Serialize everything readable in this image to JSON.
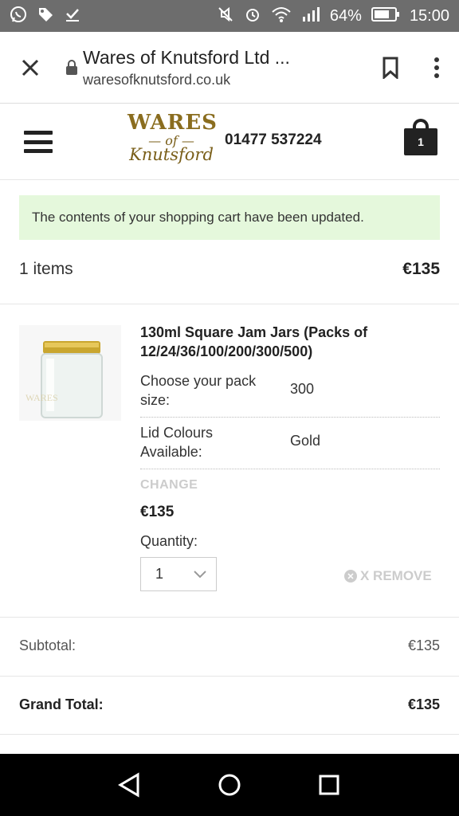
{
  "status_bar": {
    "battery": "64%",
    "time": "15:00"
  },
  "browser": {
    "page_title": "Wares of Knutsford Ltd ...",
    "url": "waresofknutsford.co.uk"
  },
  "site_header": {
    "logo_top": "WARES",
    "logo_mid": "— of —",
    "logo_bottom": "Knutsford",
    "phone": "01477 537224",
    "cart_count": "1"
  },
  "notice": "The contents of your shopping cart have been updated.",
  "cart_summary": {
    "items_count": "1 items",
    "items_total": "€135"
  },
  "product": {
    "name": "130ml Square Jam Jars (Packs of 12/24/36/100/200/300/500)",
    "options": [
      {
        "label": "Choose your pack size:",
        "value": "300"
      },
      {
        "label": "Lid Colours Available:",
        "value": "Gold"
      }
    ],
    "change_label": "CHANGE",
    "price": "€135",
    "quantity_label": "Quantity:",
    "quantity_value": "1",
    "remove_label": "X REMOVE"
  },
  "totals": {
    "subtotal_label": "Subtotal:",
    "subtotal_value": "€135",
    "grand_total_label": "Grand Total:",
    "grand_total_value": "€135"
  },
  "colors": {
    "notice_bg": "#e5f8dc",
    "status_bar_bg": "#6d6d6d",
    "logo_gold": "#8a6d1f"
  },
  "icons": {
    "status_left": [
      "whatsapp-icon",
      "tag-icon",
      "download-check-icon"
    ],
    "status_right": [
      "mute-icon",
      "alarm-icon",
      "wifi-icon",
      "signal-icon",
      "battery-icon"
    ],
    "browser": [
      "close-icon",
      "lock-icon",
      "bookmark-icon",
      "more-vert-icon"
    ],
    "nav": [
      "back-icon",
      "home-icon",
      "recents-icon"
    ]
  }
}
